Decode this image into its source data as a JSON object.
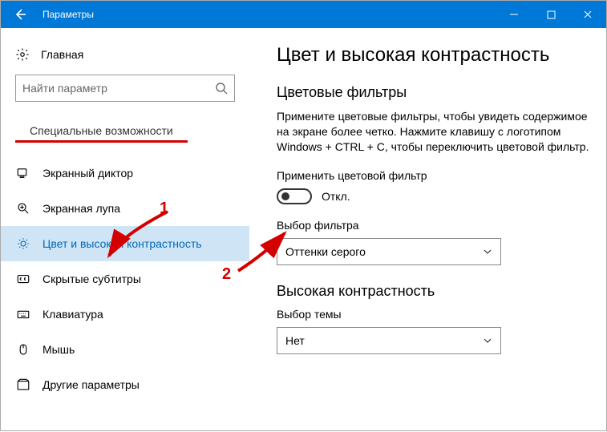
{
  "window": {
    "title": "Параметры"
  },
  "sidebar": {
    "home": "Главная",
    "search_placeholder": "Найти параметр",
    "category": "Специальные возможности",
    "items": [
      {
        "label": "Экранный диктор",
        "icon": "narrator-icon"
      },
      {
        "label": "Экранная лупа",
        "icon": "magnifier-icon"
      },
      {
        "label": "Цвет и высокая контрастность",
        "icon": "brightness-icon"
      },
      {
        "label": "Скрытые субтитры",
        "icon": "cc-icon"
      },
      {
        "label": "Клавиатура",
        "icon": "keyboard-icon"
      },
      {
        "label": "Мышь",
        "icon": "mouse-icon"
      },
      {
        "label": "Другие параметры",
        "icon": "other-icon"
      }
    ]
  },
  "main": {
    "title": "Цвет и высокая контрастность",
    "section_filters": "Цветовые фильтры",
    "filters_desc": "Примените цветовые фильтры, чтобы увидеть содержимое на экране более четко. Нажмите клавишу с логотипом Windows + CTRL + C, чтобы переключить цветовой фильтр.",
    "apply_filter_label": "Применить цветовой фильтр",
    "toggle_state": "Откл.",
    "filter_select_label": "Выбор фильтра",
    "filter_select_value": "Оттенки серого",
    "section_contrast": "Высокая контрастность",
    "theme_select_label": "Выбор темы",
    "theme_select_value": "Нет"
  },
  "annotations": {
    "one": "1",
    "two": "2"
  },
  "colors": {
    "accent": "#0078d7",
    "annotation": "#d40000"
  }
}
